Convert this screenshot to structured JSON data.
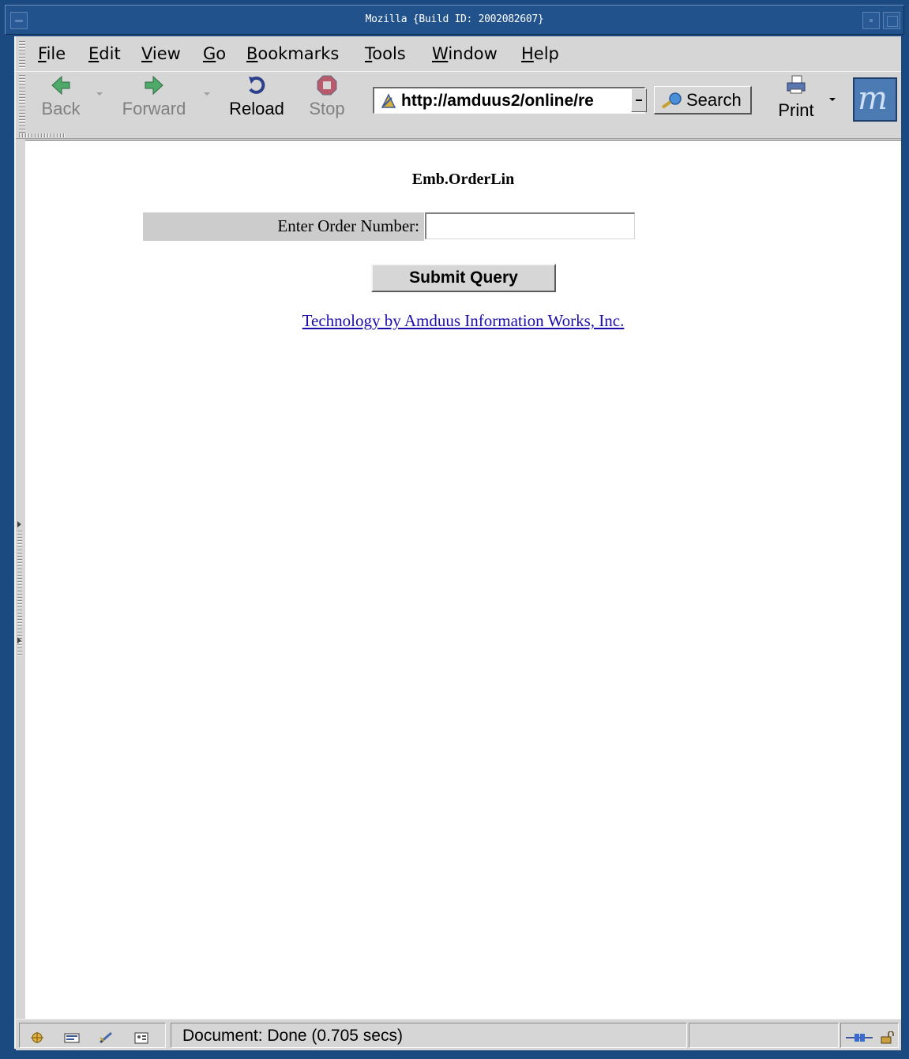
{
  "window": {
    "title": "Mozilla {Build ID: 2002082607}"
  },
  "menubar": {
    "items": [
      {
        "label": "File",
        "mnemonic": "F",
        "rest": "ile"
      },
      {
        "label": "Edit",
        "mnemonic": "E",
        "rest": "dit"
      },
      {
        "label": "View",
        "mnemonic": "V",
        "rest": "iew"
      },
      {
        "label": "Go",
        "mnemonic": "G",
        "rest": "o"
      },
      {
        "label": "Bookmarks",
        "mnemonic": "B",
        "rest": "ookmarks"
      },
      {
        "label": "Tools",
        "mnemonic": "T",
        "rest": "ools"
      },
      {
        "label": "Window",
        "mnemonic": "W",
        "rest": "indow"
      },
      {
        "label": "Help",
        "mnemonic": "H",
        "rest": "elp"
      }
    ]
  },
  "toolbar": {
    "back_label": "Back",
    "forward_label": "Forward",
    "reload_label": "Reload",
    "stop_label": "Stop",
    "url_value": "http://amduus2/online/re",
    "search_label": "Search",
    "print_label": "Print",
    "logo_letter": "m"
  },
  "page": {
    "heading": "Emb.OrderLin",
    "order_label": "Enter Order Number:",
    "order_value": "",
    "submit_label": "Submit Query",
    "credit_link": "Technology by Amduus Information Works, Inc."
  },
  "statusbar": {
    "text": "Document: Done (0.705 secs)"
  },
  "colors": {
    "titlebar": "#21528c",
    "chrome": "#d6d6d6",
    "link": "#1a0dab"
  }
}
